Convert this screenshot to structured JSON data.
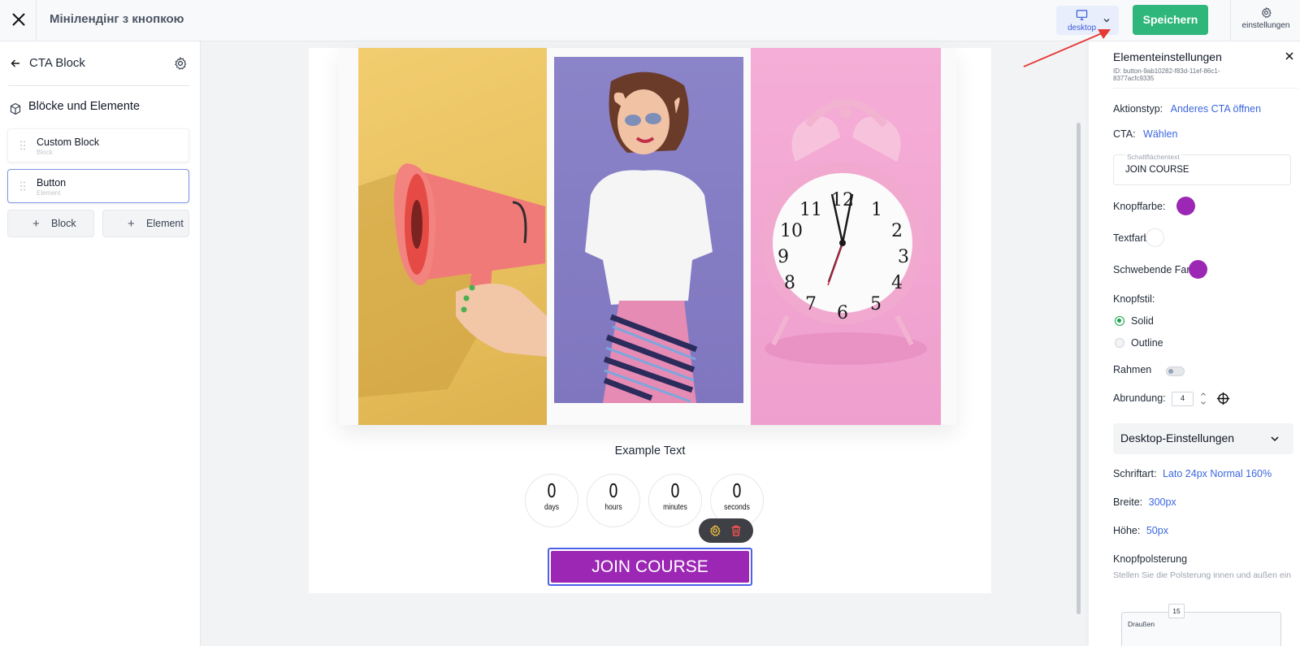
{
  "topbar": {
    "page_title": "Мінілендінг з кнопкою",
    "device_label": "desktop",
    "save_label": "Speichern",
    "settings_label": "einstellungen"
  },
  "sidebar": {
    "title": "CTA Block",
    "section_title": "Blöcke und Elemente",
    "items": [
      {
        "name": "Custom Block",
        "type": "Block"
      },
      {
        "name": "Button",
        "type": "Element"
      }
    ],
    "add_block_label": "Block",
    "add_element_label": "Element"
  },
  "canvas": {
    "example_text": "Example Text",
    "countdown": [
      {
        "value": "0",
        "unit": "days"
      },
      {
        "value": "0",
        "unit": "hours"
      },
      {
        "value": "0",
        "unit": "minutes"
      },
      {
        "value": "0",
        "unit": "seconds"
      }
    ],
    "button_label": "JOIN COURSE"
  },
  "panel": {
    "title": "Elementeinstellungen",
    "id_text": "ID: button-9ab10282-f83d-11ef-86c1-8377acfc9335",
    "action_type_label": "Aktionstyp:",
    "action_type_value": "Anderes CTA öffnen",
    "cta_label": "CTA:",
    "cta_value": "Wählen",
    "button_text_label": "Schaltflächentext",
    "button_text_value": "JOIN COURSE",
    "button_color_label": "Knopffarbe:",
    "text_color_label": "Textfarbe:",
    "hover_color_label": "Schwebende Farbe:",
    "button_style_label": "Knopfstil:",
    "style_solid": "Solid",
    "style_outline": "Outline",
    "border_label": "Rahmen",
    "rounding_label": "Abrundung:",
    "rounding_value": "4",
    "desktop_settings_label": "Desktop-Einstellungen",
    "font_label": "Schriftart:",
    "font_value": "Lato 24px Normal 160%",
    "width_label": "Breite:",
    "width_value": "300px",
    "height_label": "Höhe:",
    "height_value": "50px",
    "padding_label": "Knopfpolsterung",
    "padding_hint": "Stellen Sie die Polsterung innen und außen ein",
    "outside_label": "Draußen",
    "outside_value": "15"
  },
  "colors": {
    "accent": "#2fb67a",
    "button_color": "#9b27b4",
    "text_color": "#ffffff",
    "hover_color": "#9b27b4",
    "link": "#3b66e0"
  }
}
